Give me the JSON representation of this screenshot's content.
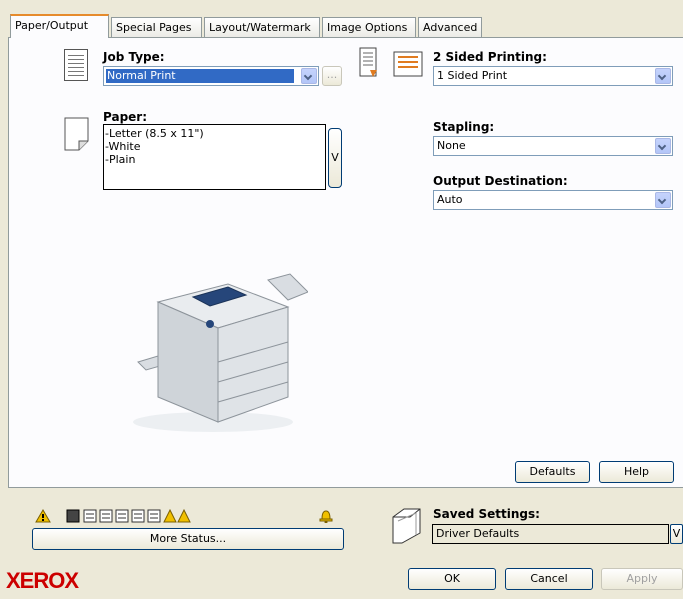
{
  "tabs": [
    {
      "label": "Paper/Output",
      "active": true
    },
    {
      "label": "Special Pages",
      "active": false
    },
    {
      "label": "Layout/Watermark",
      "active": false
    },
    {
      "label": "Image Options",
      "active": false
    },
    {
      "label": "Advanced",
      "active": false
    }
  ],
  "job_type": {
    "label": "Job Type:",
    "value": "Normal Print",
    "ellipsis": "..."
  },
  "paper": {
    "label": "Paper:",
    "lines": [
      "-Letter (8.5 x 11\")",
      "-White",
      "-Plain"
    ],
    "button": "V"
  },
  "two_sided": {
    "label": "2 Sided Printing:",
    "value": "1 Sided Print"
  },
  "stapling": {
    "label": "Stapling:",
    "value": "None"
  },
  "output_destination": {
    "label": "Output Destination:",
    "value": "Auto"
  },
  "buttons": {
    "defaults": "Defaults",
    "help": "Help",
    "more_status": "More Status...",
    "ok": "OK",
    "cancel": "Cancel",
    "apply": "Apply"
  },
  "saved_settings": {
    "label": "Saved Settings:",
    "value": "Driver Defaults",
    "button": "V"
  },
  "brand": "XEROX",
  "colors": {
    "warning": "#f0c000",
    "brand_red": "#cc0000",
    "selection": "#316ac5",
    "tab_highlight": "#e68b2c"
  }
}
